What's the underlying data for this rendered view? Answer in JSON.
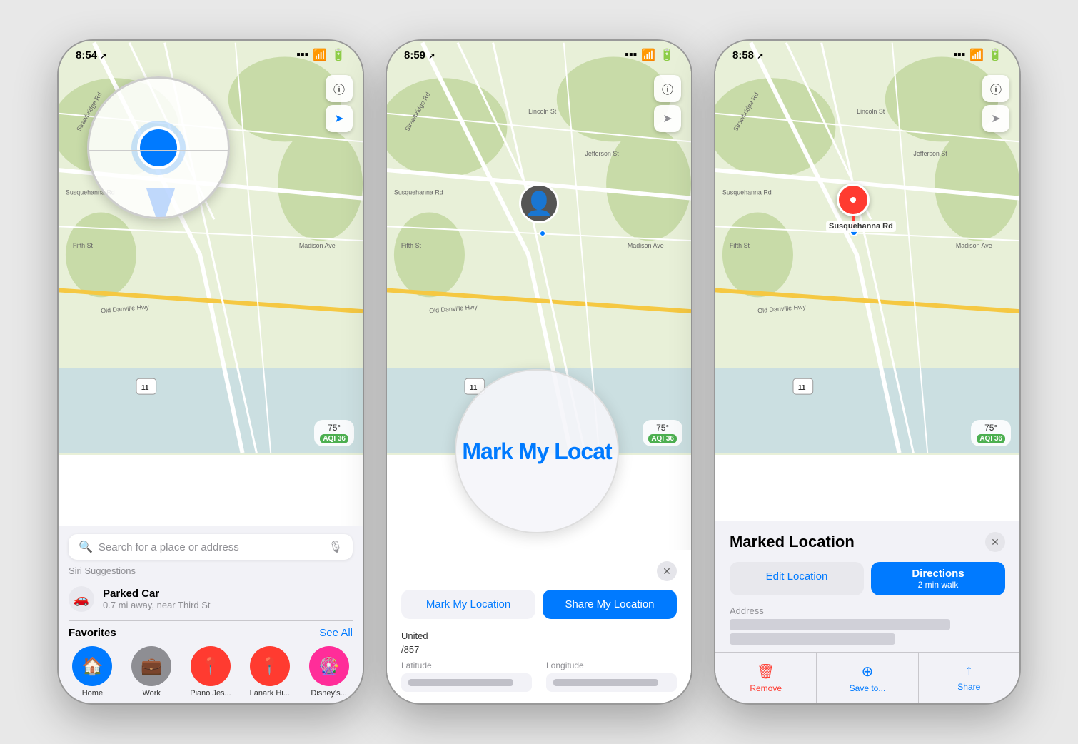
{
  "phones": [
    {
      "id": "phone1",
      "status": {
        "time": "8:54",
        "location_arrow": true
      },
      "search": {
        "placeholder": "Search for a place or address"
      },
      "siri_suggestions": {
        "title": "Siri Suggestions",
        "parked_car": {
          "name": "Parked Car",
          "distance": "0.7 mi away, near Third St"
        }
      },
      "favorites": {
        "title": "Favorites",
        "see_all": "See All",
        "items": [
          {
            "label": "Home",
            "sub": "",
            "icon": "🏠",
            "color": "#007AFF"
          },
          {
            "label": "Work",
            "sub": "",
            "icon": "💼",
            "color": "#8e8e93"
          },
          {
            "label": "Piano Jes...",
            "sub": "",
            "icon": "📍",
            "color": "#FF3B30"
          },
          {
            "label": "Lanark Hi...",
            "sub": "",
            "icon": "📍",
            "color": "#FF3B30"
          },
          {
            "label": "Disney's...",
            "sub": "",
            "icon": "🎡",
            "color": "#FF2D99"
          }
        ]
      },
      "weather": {
        "temp": "75°",
        "aqi": "AQI 36"
      }
    },
    {
      "id": "phone2",
      "status": {
        "time": "8:59",
        "location_arrow": true
      },
      "panel": {
        "mark_label": "Mark My Location",
        "share_label": "Share My Location",
        "address_partial": "United",
        "address_number": "/857",
        "latitude_label": "Latitude",
        "longitude_label": "Longitude"
      },
      "weather": {
        "temp": "75°",
        "aqi": "AQI 36"
      }
    },
    {
      "id": "phone3",
      "status": {
        "time": "8:58",
        "location_arrow": true
      },
      "panel": {
        "title": "Marked Location",
        "edit_location": "Edit Location",
        "directions": "Directions",
        "directions_sub": "2 min walk",
        "address_label": "Address",
        "remove_label": "Remove",
        "save_label": "Save to...",
        "share_label": "Share"
      },
      "pin_label": "Susquehanna Rd",
      "weather": {
        "temp": "75°",
        "aqi": "AQI 36"
      }
    }
  ]
}
